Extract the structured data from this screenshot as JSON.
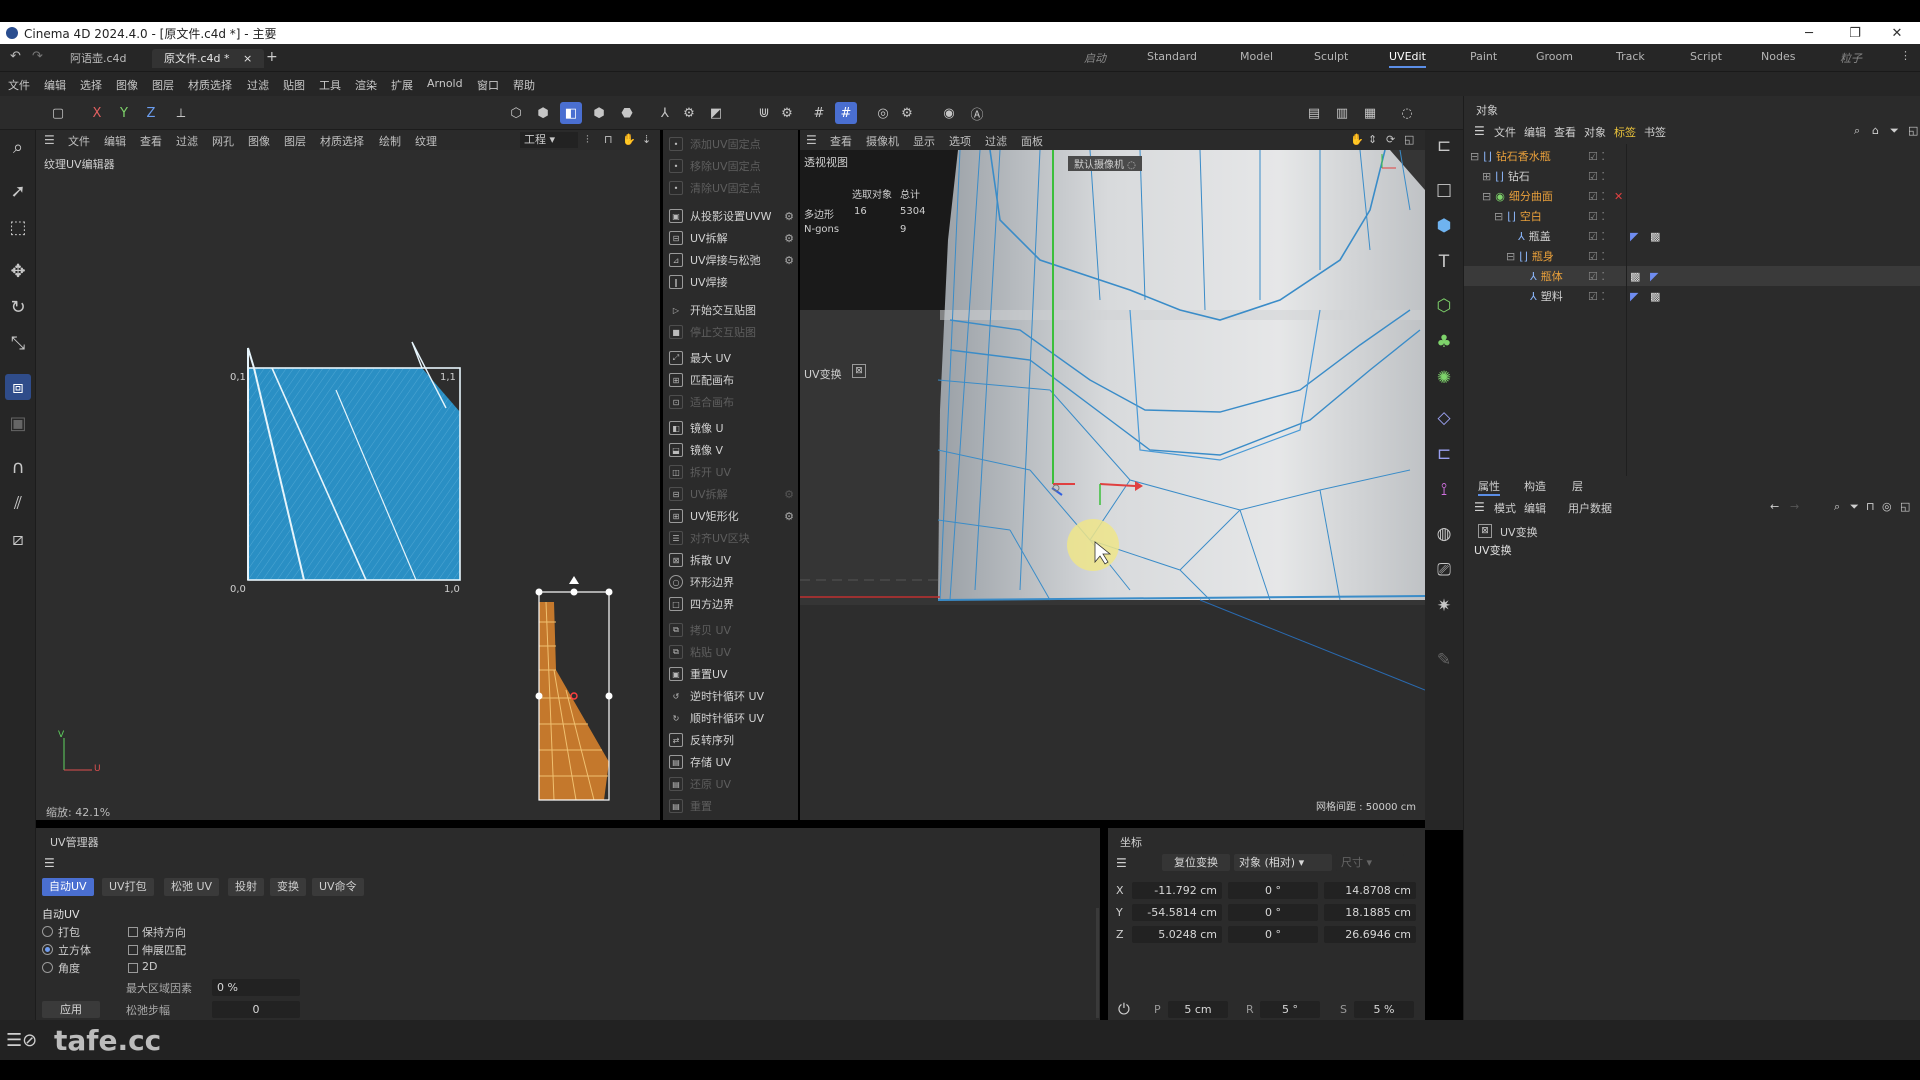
{
  "window": {
    "title": "Cinema 4D 2024.4.0 - [原文件.c4d *] - 主要"
  },
  "tabs": [
    {
      "label": "阿语壶.c4d"
    },
    {
      "label": "原文件.c4d *"
    }
  ],
  "layouts": [
    "启动",
    "Standard",
    "Model",
    "Sculpt",
    "UVEdit",
    "Paint",
    "Groom",
    "Track",
    "Script",
    "Nodes",
    "粒子"
  ],
  "menu": [
    "文件",
    "编辑",
    "选择",
    "图像",
    "图层",
    "材质选择",
    "过滤",
    "贴图",
    "工具",
    "渲染",
    "扩展",
    "Arnold",
    "窗口",
    "帮助"
  ],
  "uv_editor": {
    "menu": [
      "文件",
      "编辑",
      "查看",
      "过滤",
      "网孔",
      "图像",
      "图层",
      "材质选择",
      "绘制",
      "纹理"
    ],
    "mode_select": "工程",
    "title": "纹理UV编辑器",
    "corner_labels": {
      "tl": "0,1",
      "tr": "1,1",
      "bl": "0,0",
      "br": "1,0"
    },
    "axis_u": "U",
    "axis_v": "V",
    "zoom": "缩放: 42.1%"
  },
  "uv_commands": [
    {
      "label": "添加UV固定点",
      "enabled": false
    },
    {
      "label": "移除UV固定点",
      "enabled": false
    },
    {
      "label": "清除UV固定点",
      "enabled": false
    },
    {
      "label": "从投影设置UVW",
      "enabled": true,
      "gear": true
    },
    {
      "label": "UV拆解",
      "enabled": true,
      "gear": true
    },
    {
      "label": "UV焊接与松弛",
      "enabled": true,
      "gear": true
    },
    {
      "label": "UV焊接",
      "enabled": true
    },
    {
      "label": "开始交互贴图",
      "enabled": true
    },
    {
      "label": "停止交互贴图",
      "enabled": false
    },
    {
      "label": "最大 UV",
      "enabled": true
    },
    {
      "label": "匹配画布",
      "enabled": true
    },
    {
      "label": "适合画布",
      "enabled": false
    },
    {
      "label": "镜像 U",
      "enabled": true
    },
    {
      "label": "镜像 V",
      "enabled": true
    },
    {
      "label": "拆开 UV",
      "enabled": false
    },
    {
      "label": "UV拆解",
      "enabled": false
    },
    {
      "label": "UV矩形化",
      "enabled": true,
      "gear": true
    },
    {
      "label": "对齐UV区块",
      "enabled": false
    },
    {
      "label": "拆散 UV",
      "enabled": true
    },
    {
      "label": "环形边界",
      "enabled": true
    },
    {
      "label": "四方边界",
      "enabled": true
    },
    {
      "label": "拷贝 UV",
      "enabled": false
    },
    {
      "label": "粘贴 UV",
      "enabled": false
    },
    {
      "label": "重置UV",
      "enabled": true
    },
    {
      "label": "逆时针循环 UV",
      "enabled": true
    },
    {
      "label": "顺时针循环 UV",
      "enabled": true
    },
    {
      "label": "反转序列",
      "enabled": true
    },
    {
      "label": "存储 UV",
      "enabled": true
    },
    {
      "label": "还原 UV",
      "enabled": false
    },
    {
      "label": "重置",
      "enabled": false
    }
  ],
  "viewport": {
    "menu": [
      "查看",
      "摄像机",
      "显示",
      "选项",
      "过滤",
      "面板"
    ],
    "name": "透视视图",
    "camera": "默认摄像机",
    "stats": {
      "header_sel": "选取对象",
      "header_total": "总计",
      "rows": [
        {
          "label": "多边形",
          "sel": "16",
          "total": "5304"
        },
        {
          "label": "N-gons",
          "sel": "",
          "total": "9"
        }
      ]
    },
    "uv_transform_label": "UV变换",
    "grid_spacing": "网格间距 : 50000 cm"
  },
  "objects_panel": {
    "title": "对象",
    "menu": [
      "文件",
      "编辑",
      "查看",
      "对象",
      "标签",
      "书签"
    ],
    "tree": [
      {
        "name": "钻石香水瓶",
        "indent": 0,
        "color": "orange"
      },
      {
        "name": "钻石",
        "indent": 1,
        "color": "white"
      },
      {
        "name": "细分曲面",
        "indent": 1,
        "color": "orange"
      },
      {
        "name": "空白",
        "indent": 2,
        "color": "orange"
      },
      {
        "name": "瓶盖",
        "indent": 3,
        "color": "white"
      },
      {
        "name": "瓶身",
        "indent": 3,
        "color": "orange"
      },
      {
        "name": "瓶体",
        "indent": 4,
        "color": "orange"
      },
      {
        "name": "塑料",
        "indent": 4,
        "color": "white"
      }
    ]
  },
  "attributes_panel": {
    "tabs": [
      "属性",
      "构造",
      "层"
    ],
    "menu": [
      "模式",
      "编辑",
      "用户数据"
    ],
    "item": "UV变换",
    "heading": "UV变换"
  },
  "uv_manager": {
    "title": "UV管理器",
    "tabs": [
      "自动UV",
      "UV打包",
      "松弛 UV",
      "投射",
      "变换",
      "UV命令"
    ],
    "section": "自动UV",
    "radios": [
      "打包",
      "立方体",
      "角度"
    ],
    "selected_radio": "立方体",
    "checks": [
      "保持方向",
      "伸展匹配",
      "2D"
    ],
    "max_region_label": "最大区域因素",
    "max_region_value": "0 %",
    "relax_label": "松弛步幅",
    "relax_value": "0",
    "apply": "应用"
  },
  "coords": {
    "title": "坐标",
    "reset": "复位变换",
    "mode": "对象 (相对)",
    "size": "尺寸",
    "rows": [
      {
        "axis": "X",
        "pos": "-11.792 cm",
        "rot": "0 °",
        "size": "14.8708 cm"
      },
      {
        "axis": "Y",
        "pos": "-54.5814 cm",
        "rot": "0 °",
        "size": "18.1885 cm"
      },
      {
        "axis": "Z",
        "pos": "5.0248 cm",
        "rot": "0 °",
        "size": "26.6946 cm"
      }
    ],
    "snap": {
      "p_label": "P",
      "p": "5 cm",
      "r_label": "R",
      "r": "5 °",
      "s_label": "S",
      "s": "5 %"
    }
  },
  "watermark": "tafe.cc",
  "colors": {
    "accent": "#4a6fd1",
    "uv_blue": "#2a8fc4",
    "uv_orange": "#c4782c",
    "object_orange": "#e9a03b"
  }
}
